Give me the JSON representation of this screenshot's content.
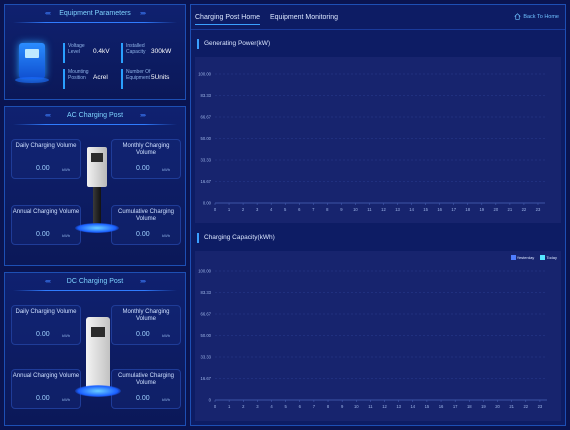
{
  "equipment": {
    "title": "Equipment Parameters",
    "params": [
      {
        "label": "Voltage Level",
        "value": "0.4kV"
      },
      {
        "label": "Installed Capacity",
        "value": "300kW"
      },
      {
        "label": "Mounting Position",
        "value": "Acrel"
      },
      {
        "label": "Number Of Equipment",
        "value": "5Units"
      }
    ]
  },
  "ac_post": {
    "title": "AC Charging Post",
    "stats": [
      {
        "label": "Daily Charging Volume",
        "value": "0.00",
        "unit": "kWh"
      },
      {
        "label": "Monthly Charging Volume",
        "value": "0.00",
        "unit": "kWh"
      },
      {
        "label": "Annual Charging Volume",
        "value": "0.00",
        "unit": "kWh"
      },
      {
        "label": "Cumulative Charging Volume",
        "value": "0.00",
        "unit": "kWh"
      }
    ]
  },
  "dc_post": {
    "title": "DC Charging Post",
    "stats": [
      {
        "label": "Daily Charging Volume",
        "value": "0.00",
        "unit": "kWh"
      },
      {
        "label": "Monthly Charging Volume",
        "value": "0.00",
        "unit": "kWh"
      },
      {
        "label": "Annual Charging Volume",
        "value": "0.00",
        "unit": "kWh"
      },
      {
        "label": "Cumulative Charging Volume",
        "value": "0.00",
        "unit": "kWh"
      }
    ]
  },
  "main": {
    "tabs": [
      {
        "label": "Charging Post Home",
        "active": true
      },
      {
        "label": "Equipment Monitoring",
        "active": false
      }
    ],
    "back_label": "Back To Home"
  },
  "chart_data": [
    {
      "type": "line",
      "title": "Generating Power(kW)",
      "x": [
        "0",
        "1",
        "2",
        "3",
        "4",
        "5",
        "6",
        "7",
        "8",
        "9",
        "10",
        "11",
        "12",
        "13",
        "14",
        "15",
        "16",
        "17",
        "18",
        "19",
        "20",
        "21",
        "22",
        "23"
      ],
      "yticks": [
        "0.00",
        "16.67",
        "33.33",
        "50.00",
        "66.67",
        "83.33",
        "100.00"
      ],
      "ylim": [
        0,
        100
      ],
      "series": []
    },
    {
      "type": "bar",
      "title": "Charging Capacity(kWh)",
      "x": [
        "0",
        "1",
        "2",
        "3",
        "4",
        "5",
        "6",
        "7",
        "8",
        "9",
        "10",
        "11",
        "12",
        "13",
        "14",
        "15",
        "16",
        "17",
        "18",
        "19",
        "20",
        "21",
        "22",
        "23"
      ],
      "yticks": [
        "0",
        "16.67",
        "33.33",
        "50.00",
        "66.67",
        "83.33",
        "100.00"
      ],
      "ylim": [
        0,
        100
      ],
      "legend": [
        {
          "name": "Yesterday",
          "color": "#4f7dff"
        },
        {
          "name": "Today",
          "color": "#56e6ff"
        }
      ],
      "series": []
    }
  ],
  "colors": {
    "accent": "#3aa0ff",
    "panel_border": "#1d4fb4",
    "background": "#0a1450"
  }
}
